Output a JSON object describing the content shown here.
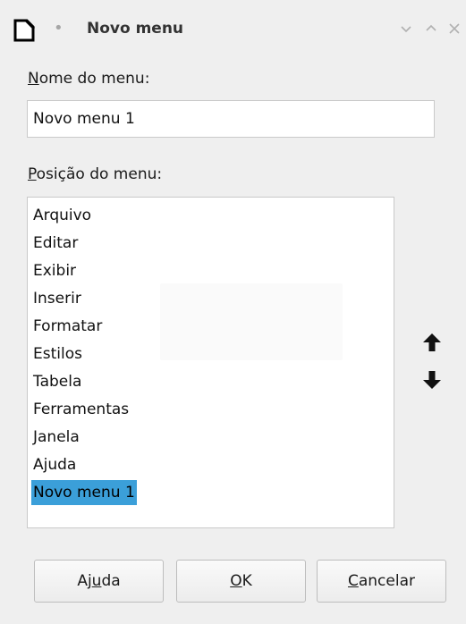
{
  "titlebar": {
    "title": "Novo menu",
    "icons": [
      "app-document-icon",
      "minimize-icon",
      "maximize-icon",
      "close-icon"
    ]
  },
  "name_field": {
    "label_mnemonic": "N",
    "label_rest": "ome do menu:",
    "value": "Novo menu 1"
  },
  "position_field": {
    "label_mnemonic": "P",
    "label_rest": "osição do menu:",
    "items": [
      "Arquivo",
      "Editar",
      "Exibir",
      "Inserir",
      "Formatar",
      "Estilos",
      "Tabela",
      "Ferramentas",
      "Janela",
      "Ajuda",
      "Novo menu 1"
    ],
    "selected_item": "Novo menu 1"
  },
  "side_buttons": {
    "up_icon": "arrow-up-icon",
    "down_icon": "arrow-down-icon"
  },
  "buttons": {
    "help_pre": "Aj",
    "help_mnemonic": "u",
    "help_post": "da",
    "ok_mnemonic": "O",
    "ok_post": "K",
    "cancel_mnemonic": "C",
    "cancel_post": "ancelar"
  },
  "colors": {
    "selection": "#3b9fd9",
    "background": "#efefef"
  }
}
